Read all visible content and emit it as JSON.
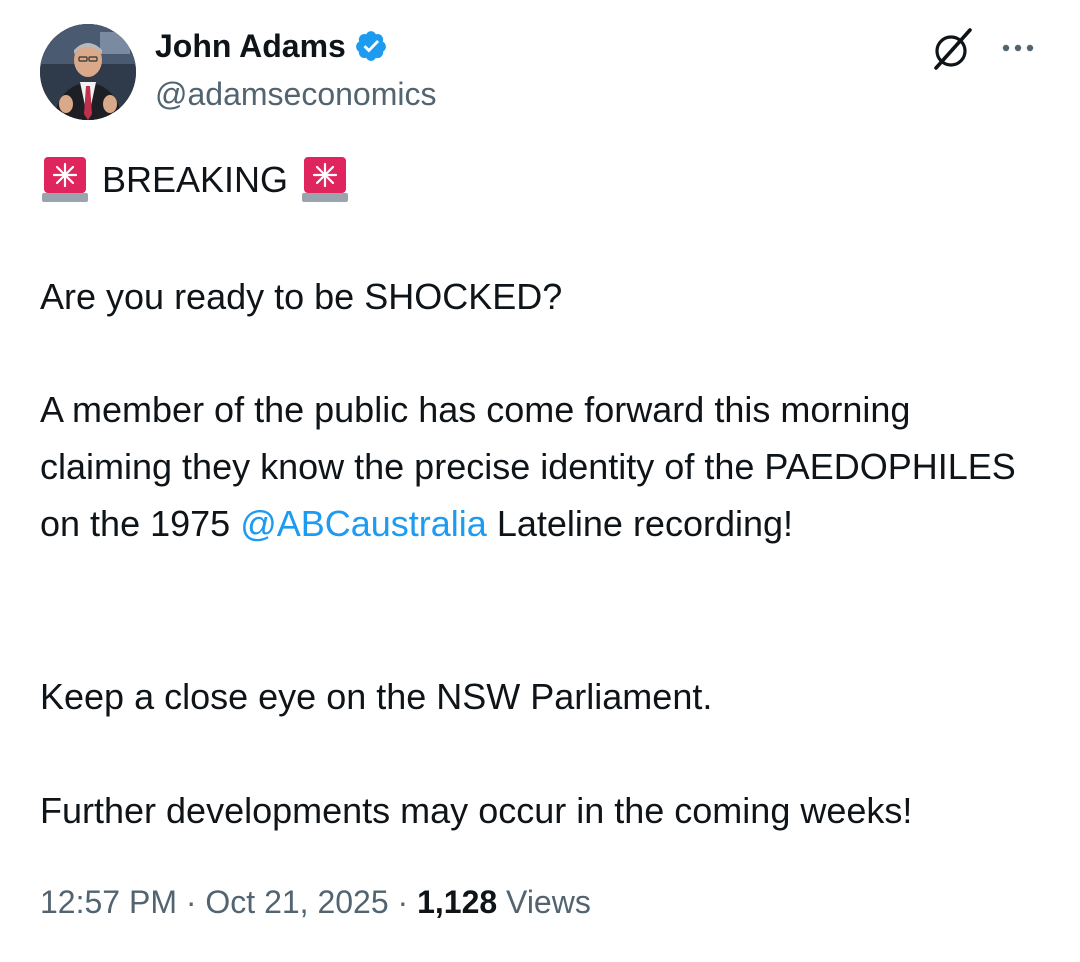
{
  "author": {
    "display_name": "John Adams",
    "handle": "@adamseconomics",
    "verified": true,
    "avatar_icon": "avatar-photo"
  },
  "header_icons": {
    "grok": "grok-icon",
    "more": "more-options-icon"
  },
  "tweet": {
    "breaking": {
      "emoji_icon": "police-siren-icon",
      "text": "BREAKING"
    },
    "question": "Are you ready to be SHOCKED?",
    "paragraph1": {
      "before_mention": "A member of the public has come forward this morning claiming they know the precise identity of the PAEDOPHILES on the 1975 ",
      "mention": "@ABCaustralia",
      "after_mention": " Lateline recording!"
    },
    "paragraph2": "Keep a close eye on the NSW Parliament.",
    "paragraph3": "Further developments may occur in the coming weeks!"
  },
  "meta": {
    "time": "12:57 PM",
    "separator": " · ",
    "date": "Oct 21, 2025",
    "views_count": "1,128",
    "views_label": " Views"
  },
  "colors": {
    "text": "#0f1419",
    "secondary": "#536471",
    "link": "#1d9bf0",
    "verified": "#1d9bf0",
    "siren": "#e0245e"
  }
}
